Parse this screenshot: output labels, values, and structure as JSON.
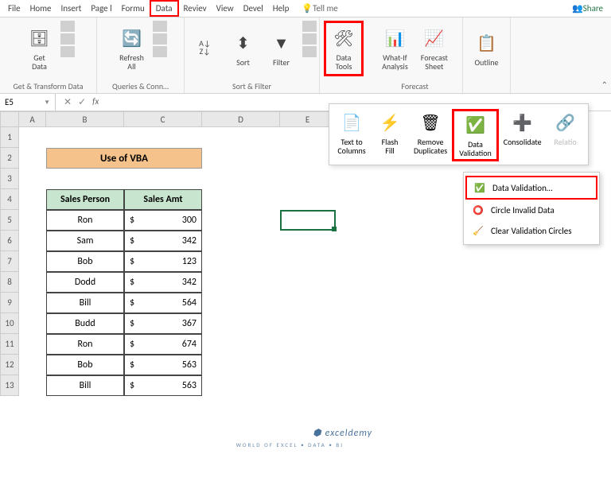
{
  "tabs": {
    "file": "File",
    "home": "Home",
    "insert": "Insert",
    "pagel": "Page l",
    "formu": "Formu",
    "data": "Data",
    "review": "Reviev",
    "view": "View",
    "devel": "Devel",
    "help": "Help",
    "tellme": "Tell me",
    "share": "Share"
  },
  "ribbon": {
    "get_data": "Get\nData",
    "refresh_all": "Refresh\nAll",
    "sort": "Sort",
    "filter": "Filter",
    "data_tools": "Data\nTools",
    "whatif": "What-If\nAnalysis",
    "forecast": "Forecast\nSheet",
    "outline": "Outline",
    "g1": "Get & Transform Data",
    "g2": "Queries & Conn…",
    "g3": "Sort & Filter",
    "g4": "Forecast"
  },
  "popup": {
    "tcols": "Text to\nColumns",
    "flash": "Flash\nFill",
    "remdup": "Remove\nDuplicates",
    "dv": "Data\nValidation",
    "consol": "Consolidate",
    "rel": "Relatio"
  },
  "dd": {
    "dv": "Data Validation…",
    "circle": "Circle Invalid Data",
    "clear": "Clear Validation Circles"
  },
  "namebox": "E5",
  "fx": "fx",
  "cols": {
    "A": "A",
    "B": "B",
    "C": "C",
    "D": "D",
    "E": "E"
  },
  "title": "Use of VBA",
  "hdrs": {
    "b": "Sales Person",
    "c": "Sales Amt"
  },
  "rows": [
    {
      "n": "Ron",
      "a": 300
    },
    {
      "n": "Sam",
      "a": 342
    },
    {
      "n": "Bob",
      "a": 123
    },
    {
      "n": "Dodd",
      "a": 342
    },
    {
      "n": "Bill",
      "a": 564
    },
    {
      "n": "Budd",
      "a": 367
    },
    {
      "n": "Ron",
      "a": 674
    },
    {
      "n": "Bob",
      "a": 563
    },
    {
      "n": "Bill",
      "a": 563
    }
  ],
  "watermark": "exceldemy",
  "watermark_sub": "WORLD OF EXCEL • DATA • BI"
}
